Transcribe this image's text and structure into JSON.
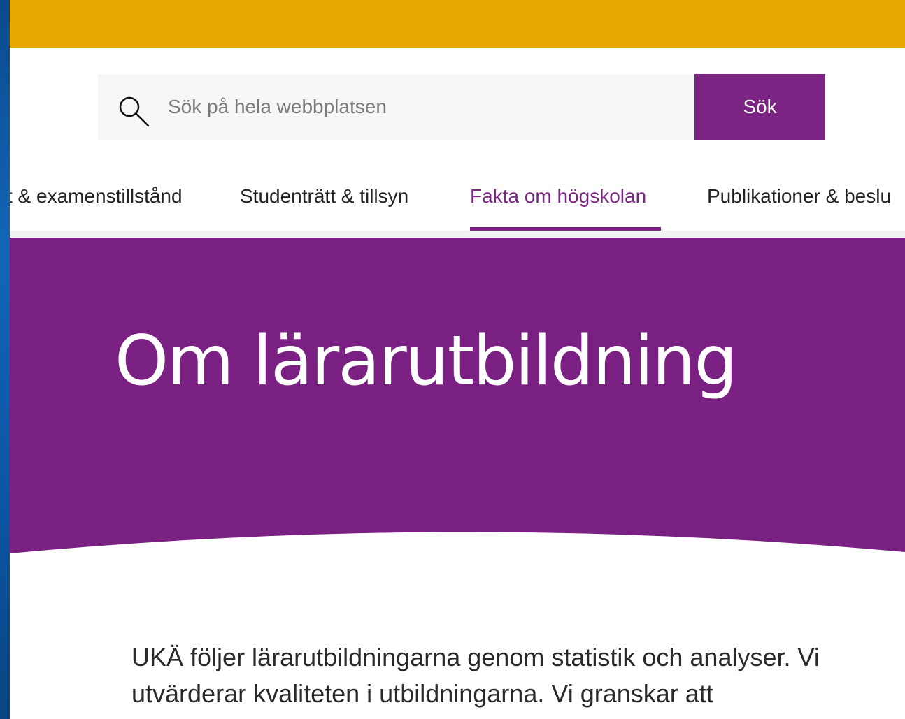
{
  "search": {
    "placeholder": "Sök på hela webbplatsen",
    "button_label": "Sök",
    "icon": "search-icon"
  },
  "nav": {
    "items": [
      {
        "label": "t & examenstillstånd",
        "active": false
      },
      {
        "label": "Studenträtt & tillsyn",
        "active": false
      },
      {
        "label": "Fakta om högskolan",
        "active": true
      },
      {
        "label": "Publikationer & beslu",
        "active": false
      }
    ]
  },
  "hero": {
    "title": "Om lärarutbildning"
  },
  "content": {
    "intro": "UKÄ följer lärarutbildningarna genom statistik och analyser. Vi utvärderar kvaliteten i utbildningarna. Vi granskar att"
  },
  "colors": {
    "topbar": "#e9aa00",
    "brand_purple": "#7b2483",
    "hero_bg": "#7a2082"
  }
}
